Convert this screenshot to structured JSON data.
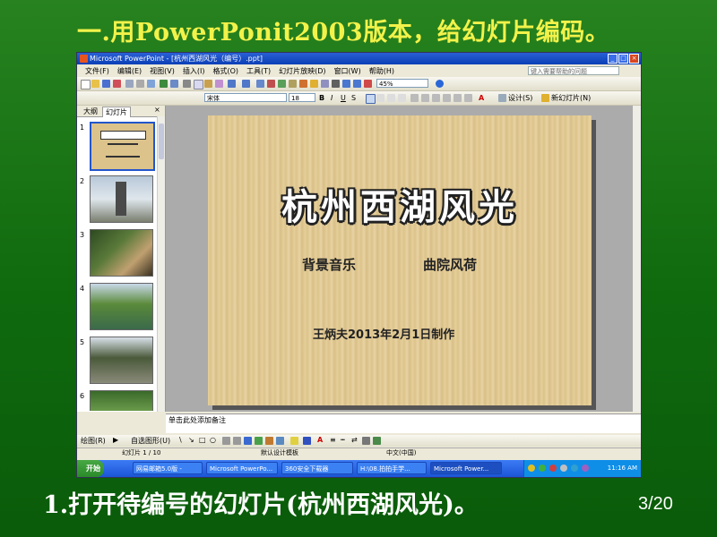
{
  "heading": "一.用PowerPonit2003版本，给幻灯片编码。",
  "caption": "1.打开待编号的幻灯片(杭州西湖风光)。",
  "page_number": "3/20",
  "window": {
    "title": "Microsoft PowerPoint - [杭州西湖风光（编号）.ppt]",
    "menu": [
      "文件(F)",
      "编辑(E)",
      "视图(V)",
      "插入(I)",
      "格式(O)",
      "工具(T)",
      "幻灯片放映(D)",
      "窗口(W)",
      "帮助(H)"
    ],
    "help_placeholder": "键入需要帮助的问题",
    "font_name": "宋体",
    "font_size": "18",
    "zoom": "45%",
    "design_label": "设计(S)",
    "new_slide_label": "新幻灯片(N)",
    "tabs": [
      "大纲",
      "幻灯片"
    ],
    "thumb_numbers": [
      "1",
      "2",
      "3",
      "4",
      "5",
      "6"
    ],
    "notes_placeholder": "单击此处添加备注",
    "draw_label": "绘图(R)",
    "autoshapes_label": "自选图形(U)",
    "status": {
      "slide": "幻灯片 1 / 10",
      "design": "默认设计模板",
      "lang": "中文(中国)"
    },
    "taskbar": {
      "start": "开始",
      "items": [
        "网易邮箱5.0版 -",
        "Microsoft PowerPo...",
        "360安全下载器",
        "H:\\08.拍拍手学...",
        "Microsoft Power..."
      ],
      "clock": "11:16 AM"
    }
  },
  "slide": {
    "title": "杭州西湖风光",
    "subtitle_left": "背景音乐",
    "subtitle_right": "曲院风荷",
    "credit": "王炳夫2013年2月1日制作"
  },
  "colors": {
    "background": "#16750f",
    "heading": "#f2f24a",
    "caption": "#ffffff"
  }
}
